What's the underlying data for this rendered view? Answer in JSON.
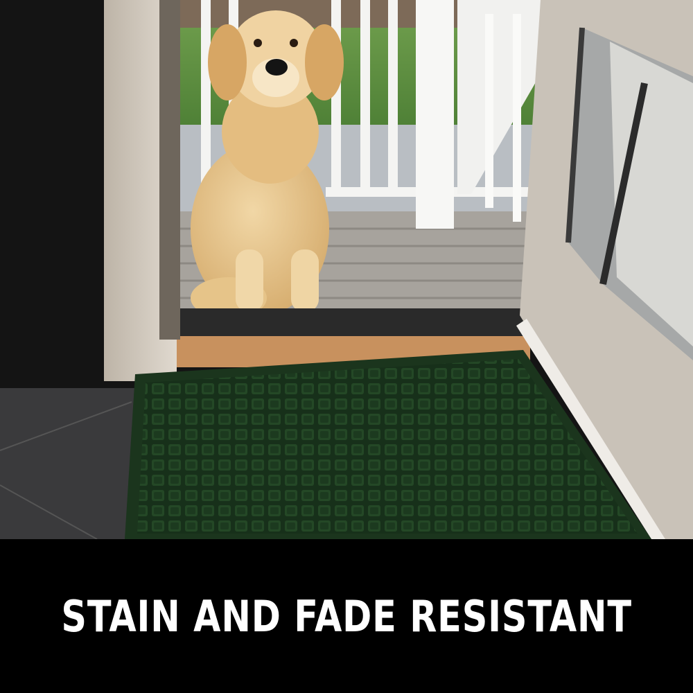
{
  "caption": {
    "text": "STAIN AND FADE RESISTANT"
  },
  "colors": {
    "mat": "#1d3a1f",
    "caption_band": "#000000",
    "caption_text": "#ffffff"
  },
  "scene": {
    "subject": "golden-retriever",
    "product": "doormat"
  }
}
